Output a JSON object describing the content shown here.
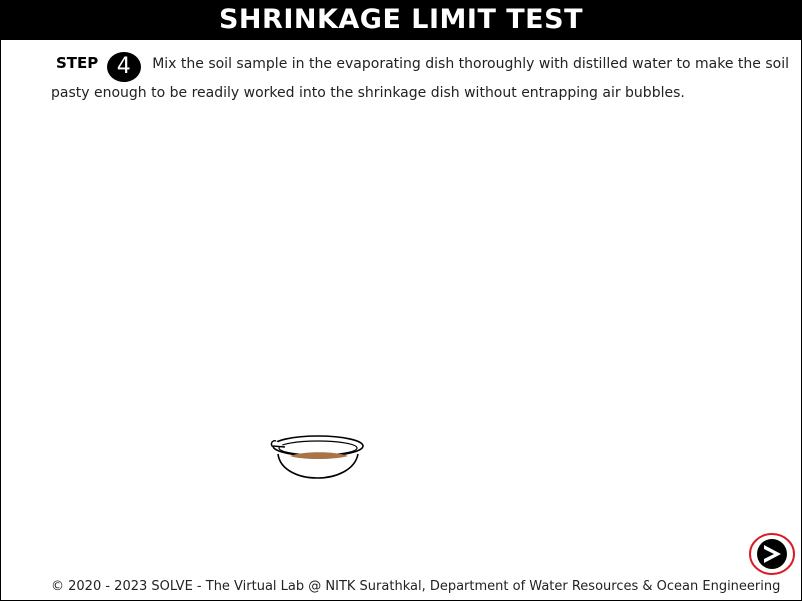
{
  "header": {
    "title": "SHRINKAGE LIMIT TEST"
  },
  "step": {
    "label": "STEP",
    "number": "4",
    "text": "Mix the soil sample in the evaporating dish thoroughly with distilled water to make the soil pasty enough to be readily worked into the shrinkage dish without entrapping air bubbles."
  },
  "illustration": {
    "icon": "evaporating-dish-icon",
    "soil_color": "#a87448"
  },
  "navigation": {
    "next_icon": "next-arrow-icon",
    "highlight_color": "#d81c24"
  },
  "footer": {
    "copyright": "© 2020 - 2023 SOLVE - The Virtual Lab @ NITK Surathkal, Department of Water Resources & Ocean Engineering"
  }
}
